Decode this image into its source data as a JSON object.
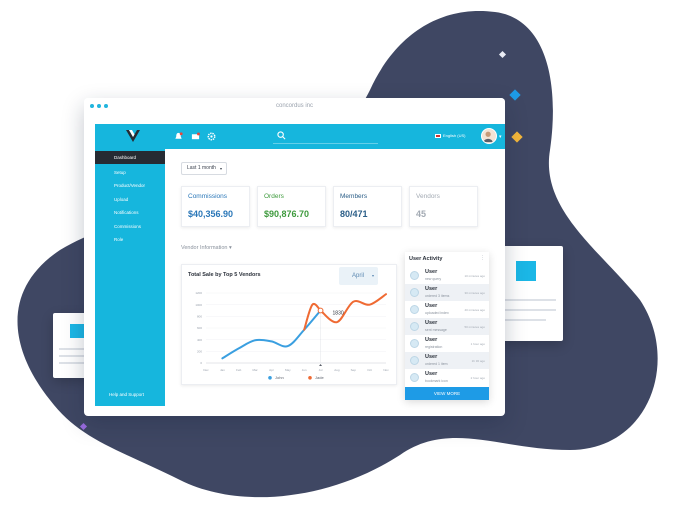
{
  "window": {
    "title": "concordus inc"
  },
  "topbar": {
    "language": "English (US)"
  },
  "sidebar": {
    "items": [
      {
        "label": "Dashboard",
        "active": true
      },
      {
        "label": "Setup"
      },
      {
        "label": "Product/Vendor"
      },
      {
        "label": "Upload"
      },
      {
        "label": "Notifications"
      },
      {
        "label": "Commissions"
      },
      {
        "label": "Role"
      }
    ],
    "help": "Help and Support"
  },
  "filter": {
    "selected": "Last 1 month"
  },
  "cards": [
    {
      "label": "Commissions",
      "value": "$40,356.90",
      "color": "#2a77b8"
    },
    {
      "label": "Orders",
      "value": "$90,876.70",
      "color": "#3d9a3c"
    },
    {
      "label": "Members",
      "value": "80/471",
      "color": "#2a5d87"
    },
    {
      "label": "Vendors",
      "value": "45",
      "color": "#a3aab3"
    }
  ],
  "vendor_info": {
    "label": "Vendor Information"
  },
  "chart_card": {
    "title": "Total Sale by Top 5 Vendors",
    "month": "April"
  },
  "chart_data": {
    "type": "line",
    "categories": [
      "Dec",
      "Jan",
      "Feb",
      "Mar",
      "Apr",
      "May",
      "Jun",
      "Jul",
      "Aug",
      "Sep",
      "Oct",
      "Nov"
    ],
    "y_ticks": [
      "0",
      "200",
      "400",
      "600",
      "800",
      "1000",
      "1200"
    ],
    "ylim": [
      0,
      1200
    ],
    "series": [
      {
        "name": "John",
        "color": "#3a9fe0",
        "values": [
          null,
          80,
          250,
          390,
          370,
          290,
          570
        ]
      },
      {
        "name": "Jade",
        "color": "#ef6a33",
        "values": [
          null,
          null,
          null,
          null,
          null,
          null,
          null,
          900,
          700,
          1050,
          1000,
          1180
        ]
      }
    ],
    "highlight": {
      "index": 7,
      "value": 1830
    },
    "legend_position": "bottom"
  },
  "activity": {
    "title": "User Activity",
    "items": [
      {
        "user": "User",
        "desc": "new query",
        "time": "10 minutes ago"
      },
      {
        "user": "User",
        "desc": "ordered 3 items",
        "time": "30 minutes ago"
      },
      {
        "user": "User",
        "desc": "uploaded index",
        "time": "40 minutes ago"
      },
      {
        "user": "User",
        "desc": "sent message",
        "time": "50 minutes ago"
      },
      {
        "user": "User",
        "desc": "registration",
        "time": "1 hour ago"
      },
      {
        "user": "User",
        "desc": "ordered 1 item",
        "time": "1h 30 ago"
      },
      {
        "user": "User",
        "desc": "bookmark icon",
        "time": "2 hour ago"
      }
    ],
    "view_more": "VIEW MORE"
  },
  "colors": {
    "brand": "#16b6dd",
    "blob": "#3f4763",
    "dark": "#262b33",
    "accent_blue": "#1e9be6"
  }
}
